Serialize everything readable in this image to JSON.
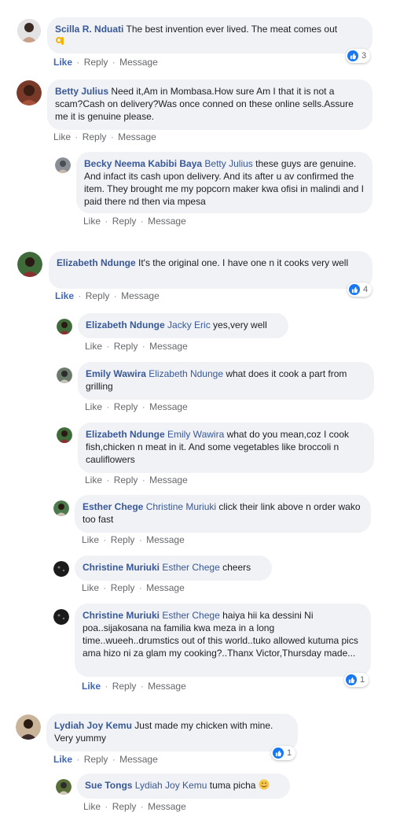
{
  "actions": {
    "like": "Like",
    "reply": "Reply",
    "message": "Message",
    "sep": "·"
  },
  "colors": {
    "author": "#385898",
    "bubble": "#f0f2f5",
    "like_blue": "#1877f2"
  },
  "comments": [
    {
      "author": "Scilla R. Nduati",
      "mention": "",
      "text": "The best invention ever lived. The meat comes out",
      "emoji": "ok-hand-emoji",
      "reactions": "3"
    },
    {
      "author": "Betty Julius",
      "mention": "",
      "text": "Need it,Am in Mombasa.How sure Am I that it is not a scam?Cash on delivery?Was once conned on these online sells.Assure me it is genuine please."
    },
    {
      "author": "Becky Neema Kabibi Baya",
      "mention": "Betty Julius",
      "text": "these guys are genuine. And infact its cash upon delivery. And its after u av confirmed the item. They brought me my popcorn maker kwa ofisi in malindi and I paid there nd then via mpesa"
    },
    {
      "author": "Elizabeth Ndunge",
      "mention": "",
      "text": "It's the original one. I have one n it cooks very well",
      "reactions": "4"
    },
    {
      "author": "Elizabeth Ndunge",
      "mention": "Jacky Eric",
      "text": "yes,very well"
    },
    {
      "author": "Emily Wawira",
      "mention": "Elizabeth Ndunge",
      "text": "what does it cook a part from grilling"
    },
    {
      "author": "Elizabeth Ndunge",
      "mention": "Emily Wawira",
      "text": "what do you mean,coz I cook fish,chicken n meat in it. And some vegetables like broccoli n cauliflowers"
    },
    {
      "author": "Esther Chege",
      "mention": "Christine Muriuki",
      "text": "click their link above n order wako too fast"
    },
    {
      "author": "Christine Muriuki",
      "mention": "Esther Chege",
      "text": "cheers"
    },
    {
      "author": "Christine Muriuki",
      "mention": "Esther Chege",
      "text": "haiya hii ka dessini Ni poa..sijakosana na familia kwa meza in a long time..wueeh..drumstics out of this world..tuko allowed kutuma pics ama hizo ni za glam my cooking?..Thanx Victor,Thursday made...",
      "reactions": "1"
    },
    {
      "author": "Lydiah Joy Kemu",
      "mention": "",
      "text": "Just made my chicken with mine. Very yummy",
      "reactions": "1"
    },
    {
      "author": "Sue Tongs",
      "mention": "Lydiah Joy Kemu",
      "text": "tuma picha",
      "emoji": "smiling-face-emoji"
    }
  ]
}
